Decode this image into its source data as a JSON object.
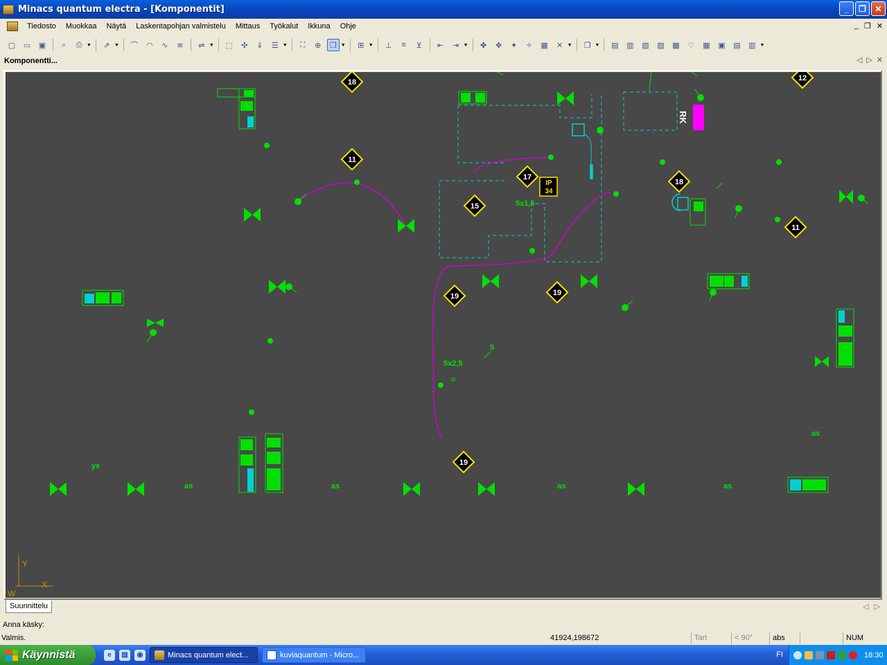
{
  "window": {
    "title": "Minacs quantum electra - [Komponentit]",
    "buttons": [
      "_",
      "❐",
      "✕"
    ]
  },
  "menu": {
    "items": [
      "Tiedosto",
      "Muokkaa",
      "Näytä",
      "Laskentapohjan valmistelu",
      "Mittaus",
      "Työkalut",
      "Ikkuna",
      "Ohje"
    ],
    "mdi_buttons": [
      "_",
      "❐",
      "✕"
    ]
  },
  "document_tab": {
    "label": "Komponentti..."
  },
  "canvas": {
    "background": "#484848",
    "component_color": "#00e000",
    "cable_color": "#d000d0",
    "dashed_color": "#00d0d0",
    "panel_color": "#ff00ff",
    "marker_color": "#ffe000",
    "markers": [
      "18",
      "11",
      "17",
      "15",
      "19",
      "19",
      "19",
      "18",
      "11",
      "12"
    ],
    "labels": {
      "ip_line1": "IP",
      "ip_line2": "34",
      "cable_a": "5x1,5",
      "cable_b": "5x2,5",
      "num_5": "5",
      "rk": "RK",
      "ys": "ys",
      "as": "as"
    },
    "axis": {
      "x": "X",
      "y": "Y",
      "w": "W"
    }
  },
  "bottom_tab": {
    "label": "Suunnittelu"
  },
  "command_line": {
    "prompt": "Anna käsky:"
  },
  "status": {
    "message": "Valmis.",
    "coords": "41924,198672",
    "tart": "Tart",
    "angle": "< 90°",
    "abs": "abs",
    "num": "NUM"
  },
  "taskbar": {
    "start": "Käynnistä",
    "tasks": [
      {
        "label": "Minacs quantum elect...",
        "active": true
      },
      {
        "label": "kuviaquantum - Micro...",
        "active": false
      }
    ],
    "language": "FI",
    "clock": "18:30"
  }
}
